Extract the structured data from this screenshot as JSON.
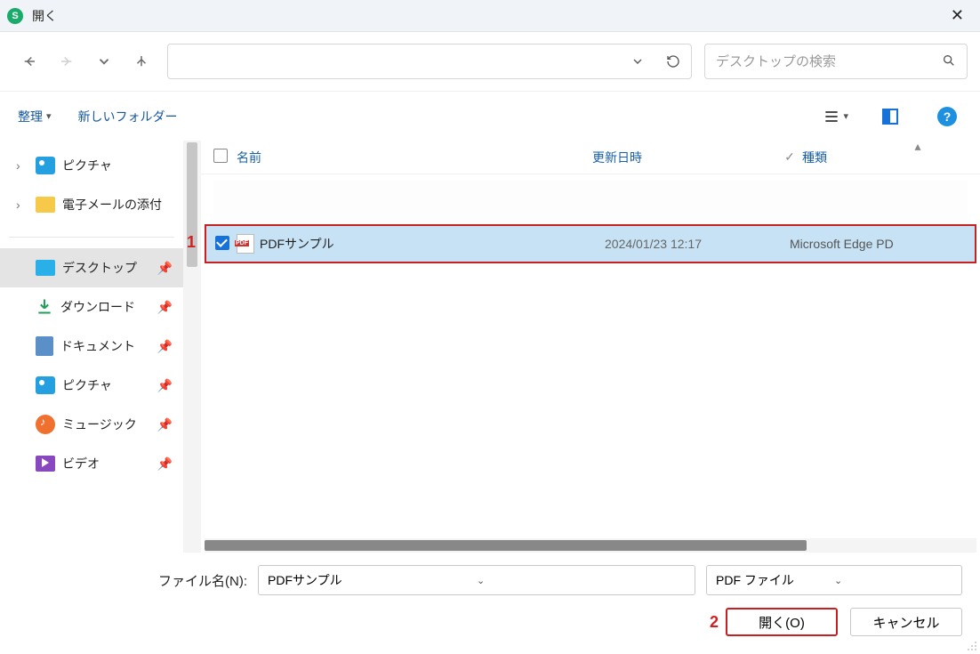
{
  "window": {
    "title": "開く"
  },
  "search": {
    "placeholder": "デスクトップの検索"
  },
  "toolbar": {
    "organize": "整理",
    "new_folder": "新しいフォルダー"
  },
  "tree_top": [
    {
      "label": "ピクチャ",
      "icon": "picture"
    },
    {
      "label": "電子メールの添付",
      "icon": "mail-folder"
    }
  ],
  "quick_access": [
    {
      "label": "デスクトップ",
      "icon": "desktop",
      "selected": true
    },
    {
      "label": "ダウンロード",
      "icon": "download"
    },
    {
      "label": "ドキュメント",
      "icon": "document"
    },
    {
      "label": "ピクチャ",
      "icon": "picture"
    },
    {
      "label": "ミュージック",
      "icon": "music"
    },
    {
      "label": "ビデオ",
      "icon": "video"
    }
  ],
  "columns": {
    "name": "名前",
    "date": "更新日時",
    "type": "種類"
  },
  "files": [
    {
      "name": "PDFサンプル",
      "date": "2024/01/23 12:17",
      "type": "Microsoft Edge PD",
      "checked": true,
      "selected": true
    }
  ],
  "footer": {
    "filename_label": "ファイル名(N):",
    "filename_value": "PDFサンプル",
    "filter_value": "PDF ファイル",
    "open_label": "開く(O)",
    "cancel_label": "キャンセル"
  },
  "callouts": {
    "one": "1",
    "two": "2"
  }
}
